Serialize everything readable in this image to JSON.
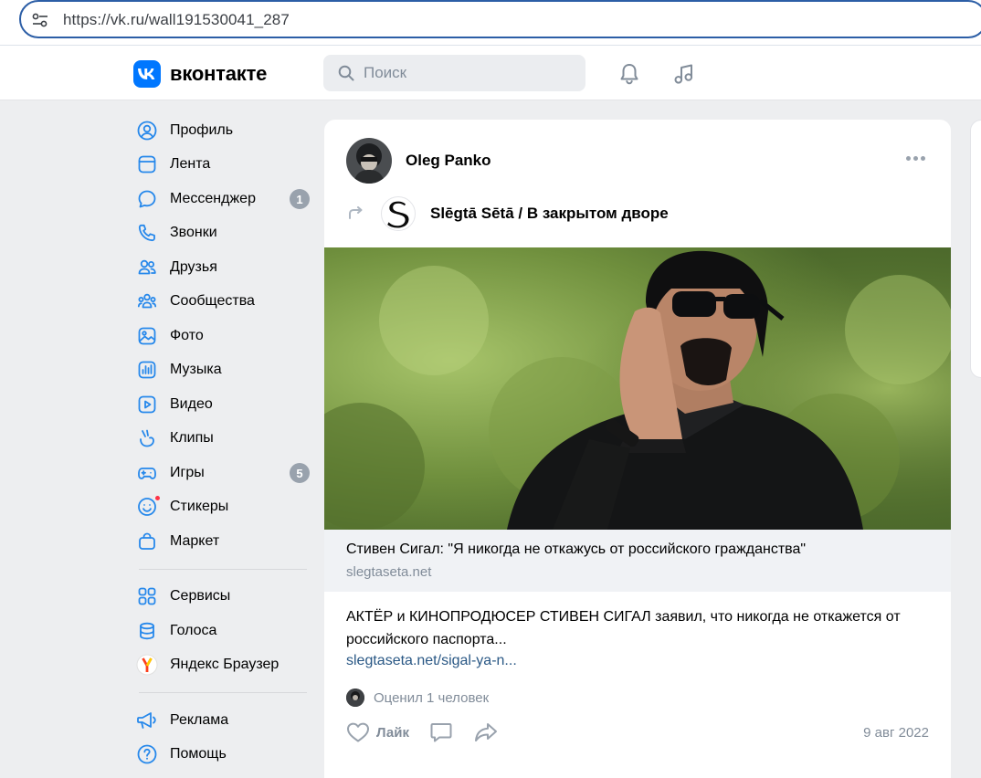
{
  "browser": {
    "url": "https://vk.ru/wall191530041_287"
  },
  "header": {
    "logo_text": "вконтакте",
    "search_placeholder": "Поиск"
  },
  "sidebar": {
    "items": [
      {
        "label": "Профиль",
        "icon": "profile-icon"
      },
      {
        "label": "Лента",
        "icon": "feed-icon"
      },
      {
        "label": "Мессенджер",
        "icon": "messenger-icon",
        "badge": "1"
      },
      {
        "label": "Звонки",
        "icon": "calls-icon"
      },
      {
        "label": "Друзья",
        "icon": "friends-icon"
      },
      {
        "label": "Сообщества",
        "icon": "communities-icon"
      },
      {
        "label": "Фото",
        "icon": "photo-icon"
      },
      {
        "label": "Музыка",
        "icon": "music-icon"
      },
      {
        "label": "Видео",
        "icon": "video-icon"
      },
      {
        "label": "Клипы",
        "icon": "clips-icon"
      },
      {
        "label": "Игры",
        "icon": "games-icon",
        "badge": "5"
      },
      {
        "label": "Стикеры",
        "icon": "stickers-icon"
      },
      {
        "label": "Маркет",
        "icon": "market-icon"
      }
    ],
    "items2": [
      {
        "label": "Сервисы",
        "icon": "services-icon"
      },
      {
        "label": "Голоса",
        "icon": "votes-icon"
      },
      {
        "label": "Яндекс Браузер",
        "icon": "yandex-browser-icon"
      }
    ],
    "items3": [
      {
        "label": "Реклама",
        "icon": "ads-icon"
      },
      {
        "label": "Помощь",
        "icon": "help-icon"
      }
    ]
  },
  "post": {
    "author": "Oleg Panko",
    "repost_source": "Slēgtā Sētā / В закрытом дворе",
    "link_title": "Стивен Сигал: \"Я никогда не откажусь от российского гражданства\"",
    "link_domain": "slegtaseta.net",
    "text": "АКТЁР и КИНОПРОДЮСЕР СТИВЕН СИГАЛ заявил, что никогда не откажется от российского паспорта...",
    "text_link": "slegtaseta.net/sigal-ya-n...",
    "likers_text": "Оценил 1 человек",
    "like_label": "Лайк",
    "date": "9 авг 2022"
  },
  "colors": {
    "accent": "#0077ff",
    "background": "#edeef0",
    "secondary_text": "#818c99",
    "link": "#2a5885",
    "icon_blue": "#2688eb"
  }
}
